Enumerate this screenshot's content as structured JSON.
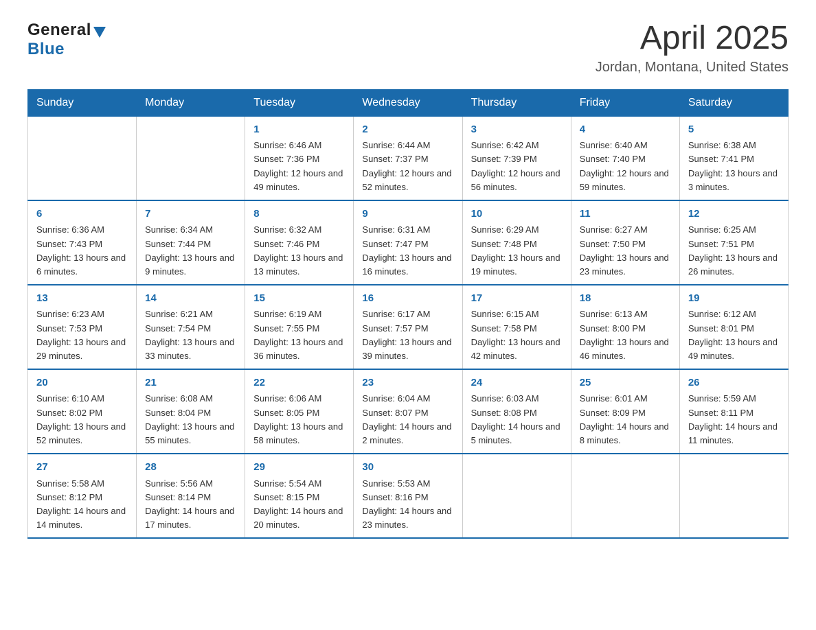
{
  "header": {
    "title": "April 2025",
    "subtitle": "Jordan, Montana, United States"
  },
  "logo": {
    "general": "General",
    "blue": "Blue"
  },
  "weekdays": [
    "Sunday",
    "Monday",
    "Tuesday",
    "Wednesday",
    "Thursday",
    "Friday",
    "Saturday"
  ],
  "weeks": [
    [
      {
        "day": "",
        "sunrise": "",
        "sunset": "",
        "daylight": ""
      },
      {
        "day": "",
        "sunrise": "",
        "sunset": "",
        "daylight": ""
      },
      {
        "day": "1",
        "sunrise": "Sunrise: 6:46 AM",
        "sunset": "Sunset: 7:36 PM",
        "daylight": "Daylight: 12 hours and 49 minutes."
      },
      {
        "day": "2",
        "sunrise": "Sunrise: 6:44 AM",
        "sunset": "Sunset: 7:37 PM",
        "daylight": "Daylight: 12 hours and 52 minutes."
      },
      {
        "day": "3",
        "sunrise": "Sunrise: 6:42 AM",
        "sunset": "Sunset: 7:39 PM",
        "daylight": "Daylight: 12 hours and 56 minutes."
      },
      {
        "day": "4",
        "sunrise": "Sunrise: 6:40 AM",
        "sunset": "Sunset: 7:40 PM",
        "daylight": "Daylight: 12 hours and 59 minutes."
      },
      {
        "day": "5",
        "sunrise": "Sunrise: 6:38 AM",
        "sunset": "Sunset: 7:41 PM",
        "daylight": "Daylight: 13 hours and 3 minutes."
      }
    ],
    [
      {
        "day": "6",
        "sunrise": "Sunrise: 6:36 AM",
        "sunset": "Sunset: 7:43 PM",
        "daylight": "Daylight: 13 hours and 6 minutes."
      },
      {
        "day": "7",
        "sunrise": "Sunrise: 6:34 AM",
        "sunset": "Sunset: 7:44 PM",
        "daylight": "Daylight: 13 hours and 9 minutes."
      },
      {
        "day": "8",
        "sunrise": "Sunrise: 6:32 AM",
        "sunset": "Sunset: 7:46 PM",
        "daylight": "Daylight: 13 hours and 13 minutes."
      },
      {
        "day": "9",
        "sunrise": "Sunrise: 6:31 AM",
        "sunset": "Sunset: 7:47 PM",
        "daylight": "Daylight: 13 hours and 16 minutes."
      },
      {
        "day": "10",
        "sunrise": "Sunrise: 6:29 AM",
        "sunset": "Sunset: 7:48 PM",
        "daylight": "Daylight: 13 hours and 19 minutes."
      },
      {
        "day": "11",
        "sunrise": "Sunrise: 6:27 AM",
        "sunset": "Sunset: 7:50 PM",
        "daylight": "Daylight: 13 hours and 23 minutes."
      },
      {
        "day": "12",
        "sunrise": "Sunrise: 6:25 AM",
        "sunset": "Sunset: 7:51 PM",
        "daylight": "Daylight: 13 hours and 26 minutes."
      }
    ],
    [
      {
        "day": "13",
        "sunrise": "Sunrise: 6:23 AM",
        "sunset": "Sunset: 7:53 PM",
        "daylight": "Daylight: 13 hours and 29 minutes."
      },
      {
        "day": "14",
        "sunrise": "Sunrise: 6:21 AM",
        "sunset": "Sunset: 7:54 PM",
        "daylight": "Daylight: 13 hours and 33 minutes."
      },
      {
        "day": "15",
        "sunrise": "Sunrise: 6:19 AM",
        "sunset": "Sunset: 7:55 PM",
        "daylight": "Daylight: 13 hours and 36 minutes."
      },
      {
        "day": "16",
        "sunrise": "Sunrise: 6:17 AM",
        "sunset": "Sunset: 7:57 PM",
        "daylight": "Daylight: 13 hours and 39 minutes."
      },
      {
        "day": "17",
        "sunrise": "Sunrise: 6:15 AM",
        "sunset": "Sunset: 7:58 PM",
        "daylight": "Daylight: 13 hours and 42 minutes."
      },
      {
        "day": "18",
        "sunrise": "Sunrise: 6:13 AM",
        "sunset": "Sunset: 8:00 PM",
        "daylight": "Daylight: 13 hours and 46 minutes."
      },
      {
        "day": "19",
        "sunrise": "Sunrise: 6:12 AM",
        "sunset": "Sunset: 8:01 PM",
        "daylight": "Daylight: 13 hours and 49 minutes."
      }
    ],
    [
      {
        "day": "20",
        "sunrise": "Sunrise: 6:10 AM",
        "sunset": "Sunset: 8:02 PM",
        "daylight": "Daylight: 13 hours and 52 minutes."
      },
      {
        "day": "21",
        "sunrise": "Sunrise: 6:08 AM",
        "sunset": "Sunset: 8:04 PM",
        "daylight": "Daylight: 13 hours and 55 minutes."
      },
      {
        "day": "22",
        "sunrise": "Sunrise: 6:06 AM",
        "sunset": "Sunset: 8:05 PM",
        "daylight": "Daylight: 13 hours and 58 minutes."
      },
      {
        "day": "23",
        "sunrise": "Sunrise: 6:04 AM",
        "sunset": "Sunset: 8:07 PM",
        "daylight": "Daylight: 14 hours and 2 minutes."
      },
      {
        "day": "24",
        "sunrise": "Sunrise: 6:03 AM",
        "sunset": "Sunset: 8:08 PM",
        "daylight": "Daylight: 14 hours and 5 minutes."
      },
      {
        "day": "25",
        "sunrise": "Sunrise: 6:01 AM",
        "sunset": "Sunset: 8:09 PM",
        "daylight": "Daylight: 14 hours and 8 minutes."
      },
      {
        "day": "26",
        "sunrise": "Sunrise: 5:59 AM",
        "sunset": "Sunset: 8:11 PM",
        "daylight": "Daylight: 14 hours and 11 minutes."
      }
    ],
    [
      {
        "day": "27",
        "sunrise": "Sunrise: 5:58 AM",
        "sunset": "Sunset: 8:12 PM",
        "daylight": "Daylight: 14 hours and 14 minutes."
      },
      {
        "day": "28",
        "sunrise": "Sunrise: 5:56 AM",
        "sunset": "Sunset: 8:14 PM",
        "daylight": "Daylight: 14 hours and 17 minutes."
      },
      {
        "day": "29",
        "sunrise": "Sunrise: 5:54 AM",
        "sunset": "Sunset: 8:15 PM",
        "daylight": "Daylight: 14 hours and 20 minutes."
      },
      {
        "day": "30",
        "sunrise": "Sunrise: 5:53 AM",
        "sunset": "Sunset: 8:16 PM",
        "daylight": "Daylight: 14 hours and 23 minutes."
      },
      {
        "day": "",
        "sunrise": "",
        "sunset": "",
        "daylight": ""
      },
      {
        "day": "",
        "sunrise": "",
        "sunset": "",
        "daylight": ""
      },
      {
        "day": "",
        "sunrise": "",
        "sunset": "",
        "daylight": ""
      }
    ]
  ]
}
